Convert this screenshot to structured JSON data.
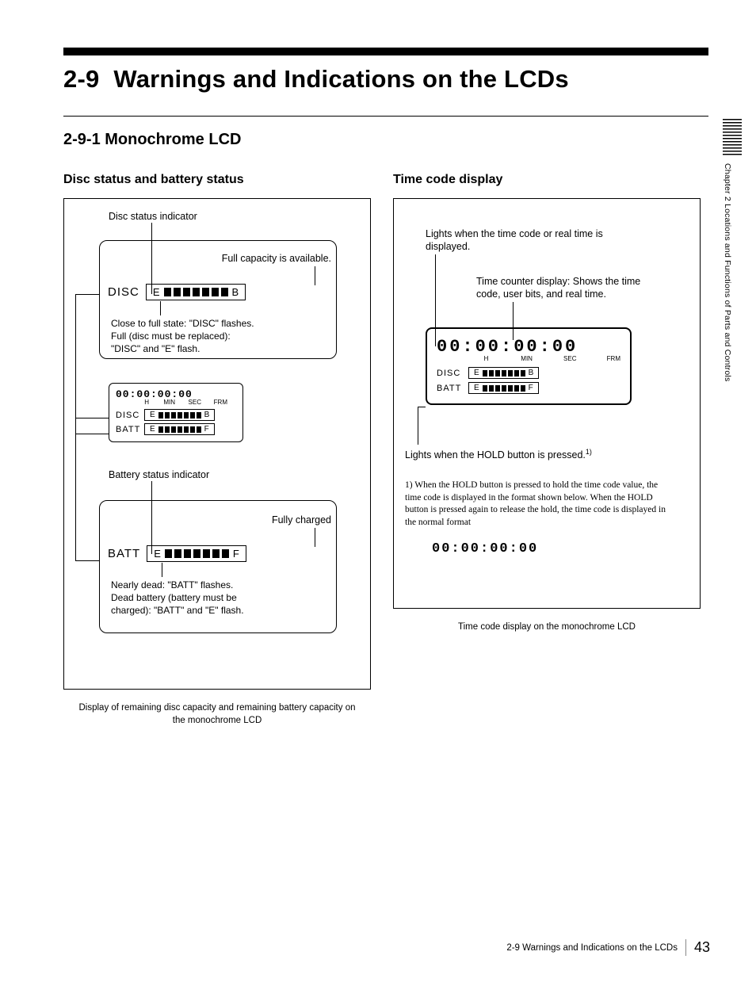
{
  "chapter_side_label": "Chapter 2   Locations and Functions of Parts and Controls",
  "section": {
    "number": "2-9",
    "title": "Warnings and Indications on the LCDs"
  },
  "subsection": "2-9-1 Monochrome LCD",
  "left": {
    "heading": "Disc status and battery status",
    "disc_indicator_label": "Disc status indicator",
    "full_capacity_label": "Full capacity is available.",
    "disc_label": "DISC",
    "meter_start": "E",
    "disc_meter_end": "B",
    "disc_note": "Close to full state: \"DISC\" flashes.\nFull (disc must be replaced):\n\"DISC\" and \"E\" flash.",
    "tc_value_small": "00:00:00:00",
    "units": {
      "h": "H",
      "min": "MIN",
      "sec": "SEC",
      "frm": "FRM"
    },
    "batt_label_small": "BATT",
    "batt_meter_end": "F",
    "battery_indicator_label": "Battery status indicator",
    "fully_charged_label": "Fully charged",
    "batt_label": "BATT",
    "batt_note": "Nearly dead: \"BATT\" flashes.\nDead battery (battery must be\ncharged): \"BATT\" and \"E\" flash.",
    "caption": "Display of remaining disc capacity and remaining battery capacity on the monochrome LCD"
  },
  "right": {
    "heading": "Time code display",
    "note_top": "Lights when the time code or real time is displayed.",
    "note_counter": "Time counter display: Shows the time code, user bits, and real time.",
    "tc_value_big": "00:00:00:00",
    "units": {
      "h": "H",
      "min": "MIN",
      "sec": "SEC",
      "frm": "FRM"
    },
    "disc_label": "DISC",
    "batt_label": "BATT",
    "meter_start": "E",
    "disc_end": "B",
    "batt_end": "F",
    "hold_note": "Lights when the HOLD button is pressed.",
    "hold_sup": "1)",
    "footnote": "1) When the HOLD button is pressed to hold the time code value, the time code is displayed in the format shown below. When the HOLD button is pressed again to release the hold, the time code is displayed in the normal format",
    "tc_value_hold": "00:00:00:00",
    "caption": "Time code display on the monochrome LCD"
  },
  "footer": {
    "text": "2-9 Warnings and Indications on the LCDs",
    "page": "43"
  }
}
